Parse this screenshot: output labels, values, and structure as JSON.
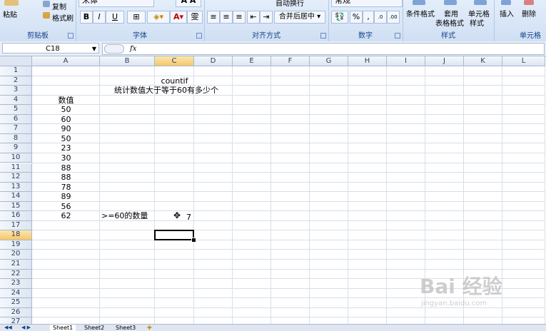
{
  "ribbon": {
    "clipboard": {
      "paste_label": "粘贴",
      "copy_label": "复制",
      "format_painter_label": "格式刷",
      "group_label": "剪贴板"
    },
    "font": {
      "font_name": "宋体",
      "bold": "B",
      "italic": "I",
      "underline": "U",
      "group_label": "字体"
    },
    "alignment": {
      "merge_label": "合并后居中",
      "wrap_label": "自动换行",
      "group_label": "对齐方式"
    },
    "number": {
      "format_name": "常规",
      "percent": "%",
      "comma": ",",
      "inc_decimal": ".0→.00",
      "dec_decimal": ".00→.0",
      "group_label": "数字"
    },
    "styles": {
      "cond_format_label": "条件格式",
      "table_format_label_1": "套用",
      "table_format_label_2": "表格格式",
      "cell_style_label_1": "单元格",
      "cell_style_label_2": "样式",
      "group_label": "样式"
    },
    "cells": {
      "insert_label": "插入",
      "delete_label": "删除",
      "group_label": "单元格"
    }
  },
  "formula_bar": {
    "name_box": "C18",
    "fx": "fx",
    "formula": ""
  },
  "columns": [
    "A",
    "B",
    "C",
    "D",
    "E",
    "F",
    "G",
    "H",
    "I",
    "J",
    "K",
    "L"
  ],
  "selected_column": "C",
  "rows": [
    "1",
    "2",
    "3",
    "4",
    "5",
    "6",
    "7",
    "8",
    "9",
    "10",
    "11",
    "12",
    "13",
    "14",
    "15",
    "16",
    "17",
    "18",
    "19",
    "20",
    "21",
    "22",
    "23",
    "24",
    "25",
    "26",
    "27"
  ],
  "selected_row": "18",
  "cells": {
    "C2": "countif",
    "B3": "统计数值大于等于60有多少个",
    "A4": "数值",
    "A5": "50",
    "A6": "60",
    "A7": "90",
    "A8": "50",
    "A9": "23",
    "A10": "30",
    "A11": "88",
    "A12": "88",
    "A13": "78",
    "A14": "89",
    "A15": "56",
    "A16": "62",
    "B16": ">=60的数量",
    "C16": "7"
  },
  "sheet_tabs": [
    "Sheet1",
    "Sheet2",
    "Sheet3"
  ],
  "watermark": {
    "brand": "Bai 经验",
    "url": "jingyan.baidu.com"
  },
  "colors": {
    "ribbon": "#dbe6f5",
    "selection_header": "#f5c76a",
    "group_label": "#15428b"
  }
}
